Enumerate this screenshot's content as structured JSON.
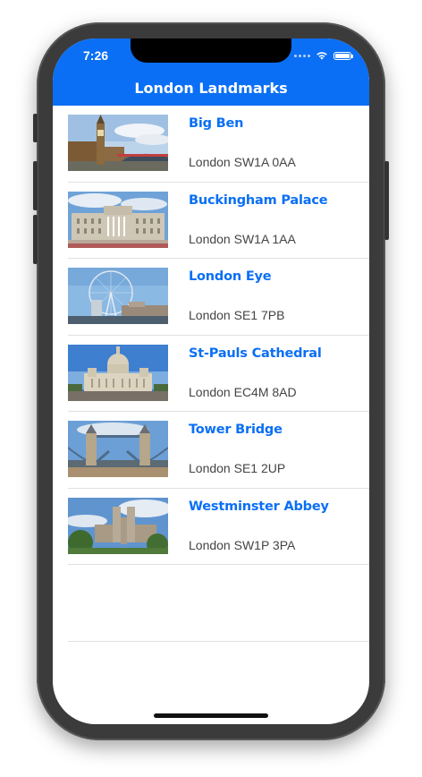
{
  "status_bar": {
    "time": "7:26",
    "wifi_icon": "wifi-icon",
    "battery_icon": "battery-icon"
  },
  "nav": {
    "title": "London Landmarks"
  },
  "landmarks": [
    {
      "name": "Big Ben",
      "postcode": "London SW1A 0AA",
      "image": "big-ben-photo"
    },
    {
      "name": "Buckingham Palace",
      "postcode": "London SW1A 1AA",
      "image": "buckingham-palace-photo"
    },
    {
      "name": "London Eye",
      "postcode": "London SE1 7PB",
      "image": "london-eye-photo"
    },
    {
      "name": "St-Pauls Cathedral",
      "postcode": "London EC4M 8AD",
      "image": "st-pauls-photo"
    },
    {
      "name": "Tower Bridge",
      "postcode": "London SE1 2UP",
      "image": "tower-bridge-photo"
    },
    {
      "name": "Westminster Abbey",
      "postcode": "London SW1P 3PA",
      "image": "westminster-abbey-photo"
    }
  ],
  "colors": {
    "accent": "#0a6ff5",
    "nav_text": "#ffffff",
    "subtitle": "#444444"
  }
}
